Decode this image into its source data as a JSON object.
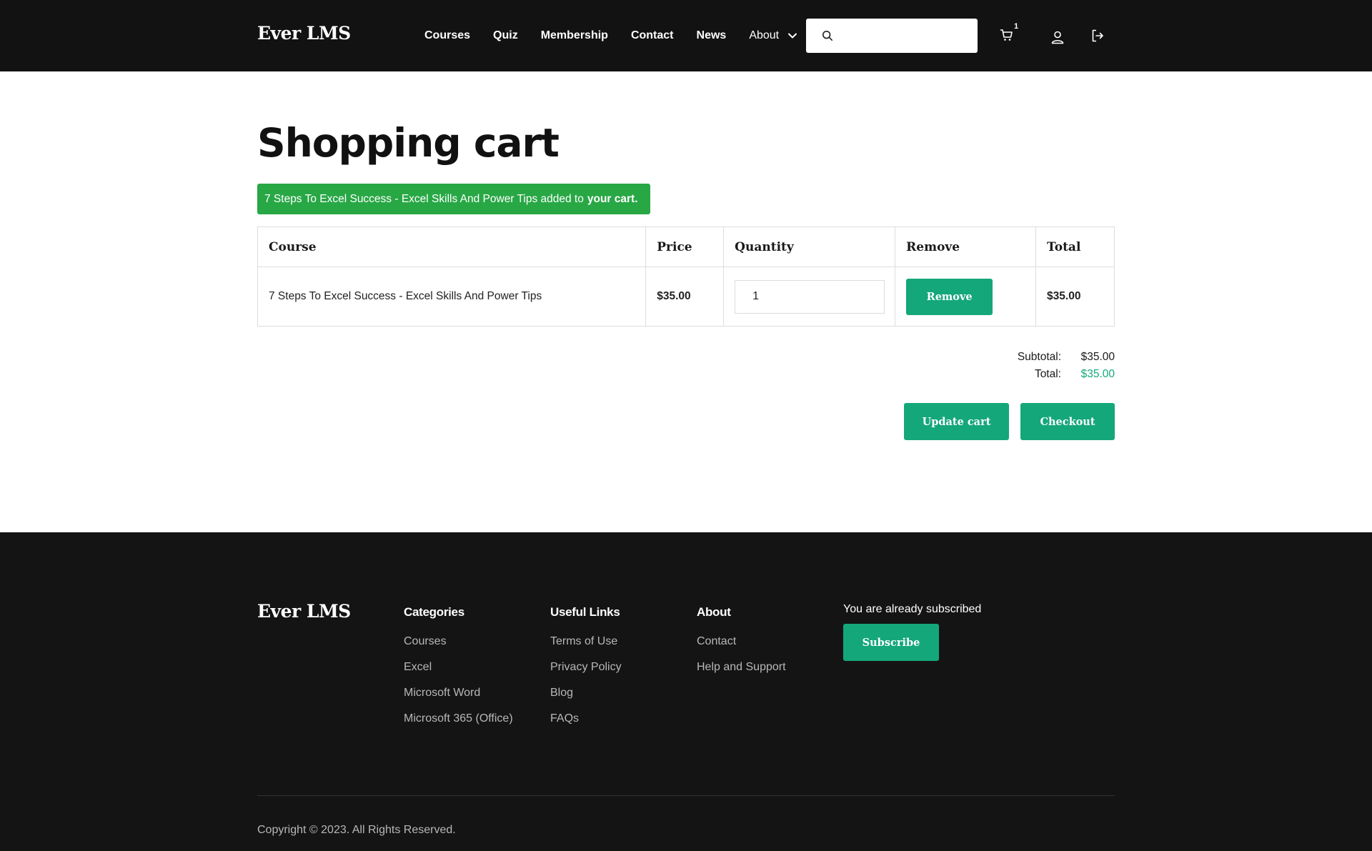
{
  "header": {
    "logo": "Ever LMS",
    "nav": [
      "Courses",
      "Quiz",
      "Membership",
      "Contact",
      "News",
      "About"
    ],
    "search_value": "",
    "cart_count": "1"
  },
  "main": {
    "title": "Shopping cart",
    "notice": {
      "text": "7 Steps To Excel Success - Excel Skills And Power Tips added to",
      "bold": "your cart."
    },
    "table": {
      "headers": [
        "Course",
        "Price",
        "Quantity",
        "Remove",
        "Total"
      ],
      "rows": [
        {
          "course": "7 Steps To Excel Success - Excel Skills And Power Tips",
          "price": "$35.00",
          "quantity": "1",
          "remove_label": "Remove",
          "total": "$35.00"
        }
      ]
    },
    "totals": {
      "subtotal_label": "Subtotal:",
      "subtotal": "$35.00",
      "total_label": "Total:",
      "total": "$35.00"
    },
    "buttons": {
      "update": "Update cart",
      "checkout": "Checkout"
    }
  },
  "footer": {
    "logo": "Ever LMS",
    "categories": {
      "title": "Categories",
      "links": [
        "Courses",
        "Excel",
        "Microsoft Word",
        "Microsoft 365 (Office)"
      ]
    },
    "useful": {
      "title": "Useful Links",
      "links": [
        "Terms of Use",
        "Privacy Policy",
        "Blog",
        "FAQs"
      ]
    },
    "about": {
      "title": "About",
      "links": [
        "Contact",
        "Help and Support"
      ]
    },
    "subscribe": {
      "status": "You are already subscribed",
      "button": "Subscribe"
    },
    "copyright": "Copyright © 2023. All Rights Reserved."
  },
  "colors": {
    "accent": "#14a77a",
    "notice": "#28a745",
    "dark": "#121212"
  },
  "icons": [
    "search-icon",
    "chevron-down-icon",
    "cart-icon",
    "user-icon",
    "logout-icon"
  ]
}
